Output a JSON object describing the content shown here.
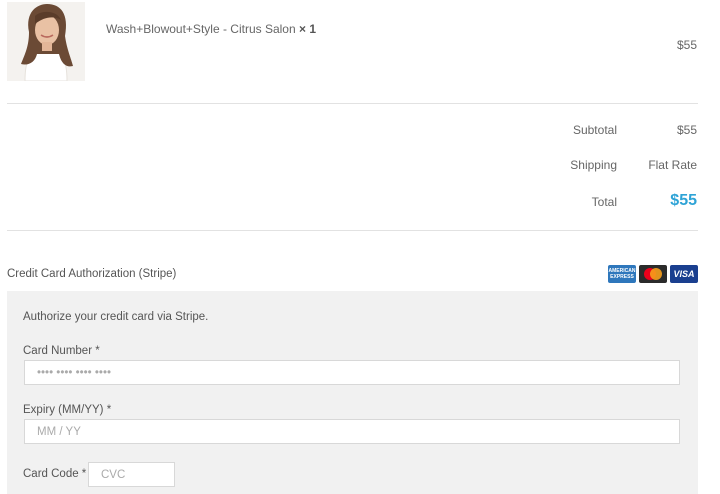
{
  "cart": {
    "item": {
      "name": "Wash+Blowout+Style - Citrus Salon",
      "quantity": "× 1",
      "price": "$55"
    }
  },
  "totals": {
    "subtotal_label": "Subtotal",
    "subtotal_value": "$55",
    "shipping_label": "Shipping",
    "shipping_value": "Flat Rate",
    "total_label": "Total",
    "total_value": "$55"
  },
  "payment": {
    "method_title": "Credit Card Authorization (Stripe)",
    "card_logos": [
      "American Express",
      "MasterCard",
      "VISA"
    ],
    "description": "Authorize your credit card via Stripe.",
    "card_number_label": "Card Number *",
    "card_number_placeholder": "•••• •••• •••• ••••",
    "expiry_label": "Expiry (MM/YY) *",
    "expiry_placeholder": "MM / YY",
    "card_code_label": "Card Code *",
    "card_code_placeholder": "CVC"
  },
  "colors": {
    "accent": "#2ea3d6",
    "panel": "#f1f1f1",
    "amex": "#2e77bc",
    "visa": "#1a1f71"
  }
}
